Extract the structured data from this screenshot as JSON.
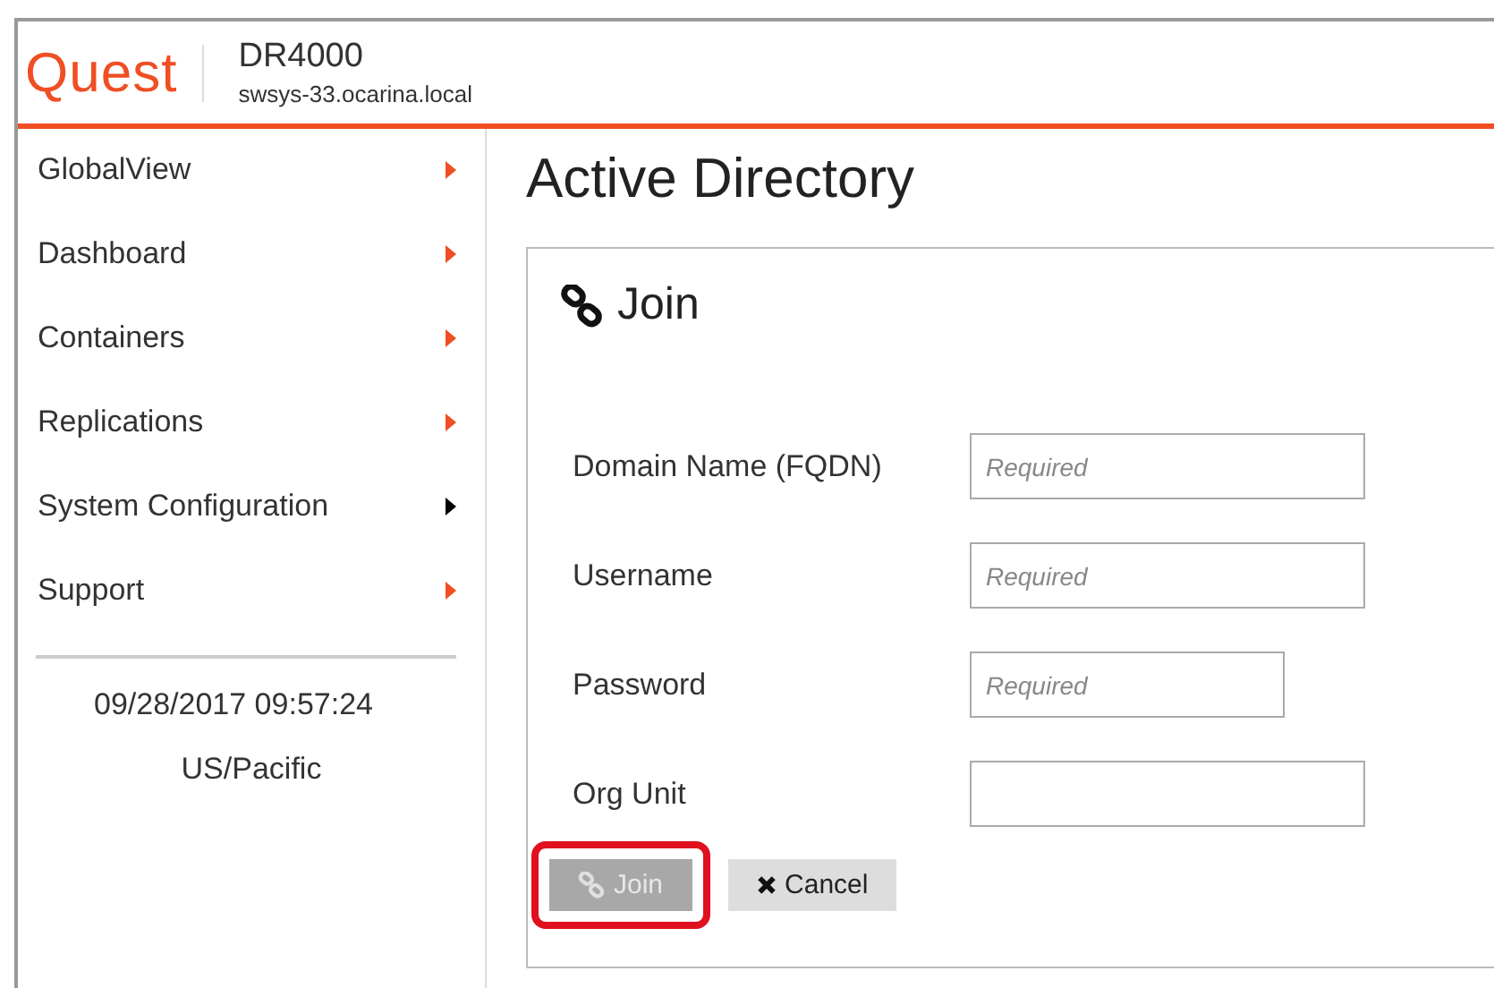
{
  "header": {
    "logo": "Quest",
    "product": "DR4000",
    "host": "swsys-33.ocarina.local"
  },
  "sidebar": {
    "items": [
      {
        "label": "GlobalView",
        "selected": false
      },
      {
        "label": "Dashboard",
        "selected": false
      },
      {
        "label": "Containers",
        "selected": false
      },
      {
        "label": "Replications",
        "selected": false
      },
      {
        "label": "System Configuration",
        "selected": true
      },
      {
        "label": "Support",
        "selected": false
      }
    ],
    "datetime": "09/28/2017 09:57:24",
    "timezone": "US/Pacific"
  },
  "page_title": "Active Directory",
  "panel": {
    "title": "Join",
    "fields": [
      {
        "label": "Domain Name (FQDN)",
        "kind": "text",
        "placeholder": "Required"
      },
      {
        "label": "Username",
        "kind": "text",
        "placeholder": "Required"
      },
      {
        "label": "Password",
        "kind": "password",
        "placeholder": "Required"
      },
      {
        "label": "Org Unit",
        "kind": "text"
      }
    ],
    "buttons": [
      {
        "label": "Join",
        "kind": "join",
        "disabled": true,
        "highlighted": true
      },
      {
        "label": "Cancel",
        "kind": "cancel",
        "disabled": false,
        "highlighted": false
      }
    ]
  }
}
